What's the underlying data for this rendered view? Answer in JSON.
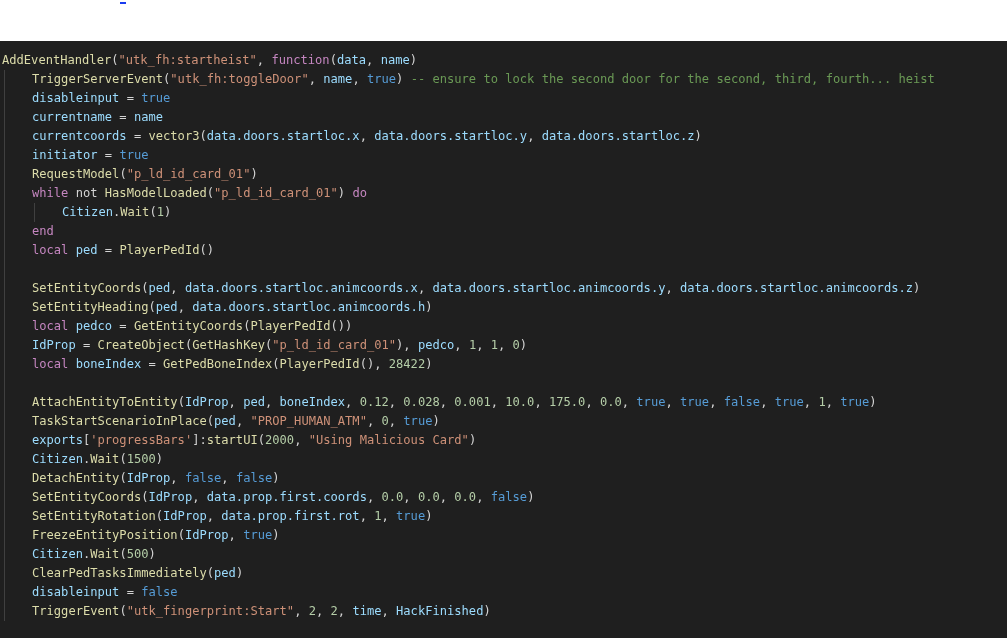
{
  "editor": {
    "lines": [
      {
        "kind": "code",
        "tokens": [
          {
            "kind": "fn",
            "text": "AddEventHandler"
          },
          {
            "kind": "punct",
            "text": "("
          },
          {
            "kind": "str",
            "text": "\"utk_fh:startheist\""
          },
          {
            "kind": "punct",
            "text": ", "
          },
          {
            "kind": "kw",
            "text": "function"
          },
          {
            "kind": "punct",
            "text": "("
          },
          {
            "kind": "var",
            "text": "data"
          },
          {
            "kind": "punct",
            "text": ", "
          },
          {
            "kind": "var",
            "text": "name"
          },
          {
            "kind": "punct",
            "text": ")"
          }
        ],
        "children": [
          {
            "kind": "code",
            "tokens": [
              {
                "kind": "fn",
                "text": "TriggerServerEvent"
              },
              {
                "kind": "punct",
                "text": "("
              },
              {
                "kind": "str",
                "text": "\"utk_fh:toggleDoor\""
              },
              {
                "kind": "punct",
                "text": ", "
              },
              {
                "kind": "var",
                "text": "name"
              },
              {
                "kind": "punct",
                "text": ", "
              },
              {
                "kind": "bool",
                "text": "true"
              },
              {
                "kind": "punct",
                "text": ") "
              },
              {
                "kind": "comment",
                "text": "-- ensure to lock the second door for the second, third, fourth... heist"
              }
            ]
          },
          {
            "kind": "code",
            "tokens": [
              {
                "kind": "var",
                "text": "disableinput"
              },
              {
                "kind": "punct",
                "text": " = "
              },
              {
                "kind": "bool",
                "text": "true"
              }
            ]
          },
          {
            "kind": "code",
            "tokens": [
              {
                "kind": "var",
                "text": "currentname"
              },
              {
                "kind": "punct",
                "text": " = "
              },
              {
                "kind": "var",
                "text": "name"
              }
            ]
          },
          {
            "kind": "code",
            "tokens": [
              {
                "kind": "var",
                "text": "currentcoords"
              },
              {
                "kind": "punct",
                "text": " = "
              },
              {
                "kind": "fn",
                "text": "vector3"
              },
              {
                "kind": "punct",
                "text": "("
              },
              {
                "kind": "var",
                "text": "data.doors.startloc.x"
              },
              {
                "kind": "punct",
                "text": ", "
              },
              {
                "kind": "var",
                "text": "data.doors.startloc.y"
              },
              {
                "kind": "punct",
                "text": ", "
              },
              {
                "kind": "var",
                "text": "data.doors.startloc.z"
              },
              {
                "kind": "punct",
                "text": ")"
              }
            ]
          },
          {
            "kind": "code",
            "tokens": [
              {
                "kind": "var",
                "text": "initiator"
              },
              {
                "kind": "punct",
                "text": " = "
              },
              {
                "kind": "bool",
                "text": "true"
              }
            ]
          },
          {
            "kind": "code",
            "tokens": [
              {
                "kind": "fn",
                "text": "RequestModel"
              },
              {
                "kind": "punct",
                "text": "("
              },
              {
                "kind": "str",
                "text": "\"p_ld_id_card_01\""
              },
              {
                "kind": "punct",
                "text": ")"
              }
            ]
          },
          {
            "kind": "code",
            "tokens": [
              {
                "kind": "kw",
                "text": "while"
              },
              {
                "kind": "punct",
                "text": " not "
              },
              {
                "kind": "fn",
                "text": "HasModelLoaded"
              },
              {
                "kind": "punct",
                "text": "("
              },
              {
                "kind": "str",
                "text": "\"p_ld_id_card_01\""
              },
              {
                "kind": "punct",
                "text": ") "
              },
              {
                "kind": "kw",
                "text": "do"
              }
            ],
            "children": [
              {
                "kind": "code",
                "tokens": [
                  {
                    "kind": "var",
                    "text": "Citizen"
                  },
                  {
                    "kind": "punct",
                    "text": "."
                  },
                  {
                    "kind": "fn",
                    "text": "Wait"
                  },
                  {
                    "kind": "punct",
                    "text": "("
                  },
                  {
                    "kind": "num",
                    "text": "1"
                  },
                  {
                    "kind": "punct",
                    "text": ")"
                  }
                ]
              }
            ]
          },
          {
            "kind": "code",
            "tokens": [
              {
                "kind": "kw",
                "text": "end"
              }
            ]
          },
          {
            "kind": "code",
            "tokens": [
              {
                "kind": "kw",
                "text": "local"
              },
              {
                "kind": "var",
                "text": " ped"
              },
              {
                "kind": "punct",
                "text": " = "
              },
              {
                "kind": "fn",
                "text": "PlayerPedId"
              },
              {
                "kind": "punct",
                "text": "()"
              }
            ]
          },
          {
            "kind": "blank"
          },
          {
            "kind": "code",
            "tokens": [
              {
                "kind": "fn",
                "text": "SetEntityCoords"
              },
              {
                "kind": "punct",
                "text": "("
              },
              {
                "kind": "var",
                "text": "ped"
              },
              {
                "kind": "punct",
                "text": ", "
              },
              {
                "kind": "var",
                "text": "data.doors.startloc.animcoords.x"
              },
              {
                "kind": "punct",
                "text": ", "
              },
              {
                "kind": "var",
                "text": "data.doors.startloc.animcoords.y"
              },
              {
                "kind": "punct",
                "text": ", "
              },
              {
                "kind": "var",
                "text": "data.doors.startloc.animcoords.z"
              },
              {
                "kind": "punct",
                "text": ")"
              }
            ]
          },
          {
            "kind": "code",
            "tokens": [
              {
                "kind": "fn",
                "text": "SetEntityHeading"
              },
              {
                "kind": "punct",
                "text": "("
              },
              {
                "kind": "var",
                "text": "ped"
              },
              {
                "kind": "punct",
                "text": ", "
              },
              {
                "kind": "var",
                "text": "data.doors.startloc.animcoords.h"
              },
              {
                "kind": "punct",
                "text": ")"
              }
            ]
          },
          {
            "kind": "code",
            "tokens": [
              {
                "kind": "kw",
                "text": "local"
              },
              {
                "kind": "var",
                "text": " pedco"
              },
              {
                "kind": "punct",
                "text": " = "
              },
              {
                "kind": "fn",
                "text": "GetEntityCoords"
              },
              {
                "kind": "punct",
                "text": "("
              },
              {
                "kind": "fn",
                "text": "PlayerPedId"
              },
              {
                "kind": "punct",
                "text": "())"
              }
            ]
          },
          {
            "kind": "code",
            "tokens": [
              {
                "kind": "var",
                "text": "IdProp"
              },
              {
                "kind": "punct",
                "text": " = "
              },
              {
                "kind": "fn",
                "text": "CreateObject"
              },
              {
                "kind": "punct",
                "text": "("
              },
              {
                "kind": "fn",
                "text": "GetHashKey"
              },
              {
                "kind": "punct",
                "text": "("
              },
              {
                "kind": "str",
                "text": "\"p_ld_id_card_01\""
              },
              {
                "kind": "punct",
                "text": "), "
              },
              {
                "kind": "var",
                "text": "pedco"
              },
              {
                "kind": "punct",
                "text": ", "
              },
              {
                "kind": "num",
                "text": "1"
              },
              {
                "kind": "punct",
                "text": ", "
              },
              {
                "kind": "num",
                "text": "1"
              },
              {
                "kind": "punct",
                "text": ", "
              },
              {
                "kind": "num",
                "text": "0"
              },
              {
                "kind": "punct",
                "text": ")"
              }
            ]
          },
          {
            "kind": "code",
            "tokens": [
              {
                "kind": "kw",
                "text": "local"
              },
              {
                "kind": "var",
                "text": " boneIndex"
              },
              {
                "kind": "punct",
                "text": " = "
              },
              {
                "kind": "fn",
                "text": "GetPedBoneIndex"
              },
              {
                "kind": "punct",
                "text": "("
              },
              {
                "kind": "fn",
                "text": "PlayerPedId"
              },
              {
                "kind": "punct",
                "text": "(), "
              },
              {
                "kind": "num",
                "text": "28422"
              },
              {
                "kind": "punct",
                "text": ")"
              }
            ]
          },
          {
            "kind": "blank"
          },
          {
            "kind": "code",
            "tokens": [
              {
                "kind": "fn",
                "text": "AttachEntityToEntity"
              },
              {
                "kind": "punct",
                "text": "("
              },
              {
                "kind": "var",
                "text": "IdProp"
              },
              {
                "kind": "punct",
                "text": ", "
              },
              {
                "kind": "var",
                "text": "ped"
              },
              {
                "kind": "punct",
                "text": ", "
              },
              {
                "kind": "var",
                "text": "boneIndex"
              },
              {
                "kind": "punct",
                "text": ", "
              },
              {
                "kind": "num",
                "text": "0.12"
              },
              {
                "kind": "punct",
                "text": ", "
              },
              {
                "kind": "num",
                "text": "0.028"
              },
              {
                "kind": "punct",
                "text": ", "
              },
              {
                "kind": "num",
                "text": "0.001"
              },
              {
                "kind": "punct",
                "text": ", "
              },
              {
                "kind": "num",
                "text": "10.0"
              },
              {
                "kind": "punct",
                "text": ", "
              },
              {
                "kind": "num",
                "text": "175.0"
              },
              {
                "kind": "punct",
                "text": ", "
              },
              {
                "kind": "num",
                "text": "0.0"
              },
              {
                "kind": "punct",
                "text": ", "
              },
              {
                "kind": "bool",
                "text": "true"
              },
              {
                "kind": "punct",
                "text": ", "
              },
              {
                "kind": "bool",
                "text": "true"
              },
              {
                "kind": "punct",
                "text": ", "
              },
              {
                "kind": "bool",
                "text": "false"
              },
              {
                "kind": "punct",
                "text": ", "
              },
              {
                "kind": "bool",
                "text": "true"
              },
              {
                "kind": "punct",
                "text": ", "
              },
              {
                "kind": "num",
                "text": "1"
              },
              {
                "kind": "punct",
                "text": ", "
              },
              {
                "kind": "bool",
                "text": "true"
              },
              {
                "kind": "punct",
                "text": ")"
              }
            ]
          },
          {
            "kind": "code",
            "tokens": [
              {
                "kind": "fn",
                "text": "TaskStartScenarioInPlace"
              },
              {
                "kind": "punct",
                "text": "("
              },
              {
                "kind": "var",
                "text": "ped"
              },
              {
                "kind": "punct",
                "text": ", "
              },
              {
                "kind": "str",
                "text": "\"PROP_HUMAN_ATM\""
              },
              {
                "kind": "punct",
                "text": ", "
              },
              {
                "kind": "num",
                "text": "0"
              },
              {
                "kind": "punct",
                "text": ", "
              },
              {
                "kind": "bool",
                "text": "true"
              },
              {
                "kind": "punct",
                "text": ")"
              }
            ]
          },
          {
            "kind": "code",
            "tokens": [
              {
                "kind": "var",
                "text": "exports"
              },
              {
                "kind": "punct",
                "text": "["
              },
              {
                "kind": "str",
                "text": "'progressBars'"
              },
              {
                "kind": "punct",
                "text": "]:"
              },
              {
                "kind": "fn",
                "text": "startUI"
              },
              {
                "kind": "punct",
                "text": "("
              },
              {
                "kind": "num",
                "text": "2000"
              },
              {
                "kind": "punct",
                "text": ", "
              },
              {
                "kind": "str",
                "text": "\"Using Malicious Card\""
              },
              {
                "kind": "punct",
                "text": ")"
              }
            ]
          },
          {
            "kind": "code",
            "tokens": [
              {
                "kind": "var",
                "text": "Citizen"
              },
              {
                "kind": "punct",
                "text": "."
              },
              {
                "kind": "fn",
                "text": "Wait"
              },
              {
                "kind": "punct",
                "text": "("
              },
              {
                "kind": "num",
                "text": "1500"
              },
              {
                "kind": "punct",
                "text": ")"
              }
            ]
          },
          {
            "kind": "code",
            "tokens": [
              {
                "kind": "fn",
                "text": "DetachEntity"
              },
              {
                "kind": "punct",
                "text": "("
              },
              {
                "kind": "var",
                "text": "IdProp"
              },
              {
                "kind": "punct",
                "text": ", "
              },
              {
                "kind": "bool",
                "text": "false"
              },
              {
                "kind": "punct",
                "text": ", "
              },
              {
                "kind": "bool",
                "text": "false"
              },
              {
                "kind": "punct",
                "text": ")"
              }
            ]
          },
          {
            "kind": "code",
            "tokens": [
              {
                "kind": "fn",
                "text": "SetEntityCoords"
              },
              {
                "kind": "punct",
                "text": "("
              },
              {
                "kind": "var",
                "text": "IdProp"
              },
              {
                "kind": "punct",
                "text": ", "
              },
              {
                "kind": "var",
                "text": "data.prop.first.coords"
              },
              {
                "kind": "punct",
                "text": ", "
              },
              {
                "kind": "num",
                "text": "0.0"
              },
              {
                "kind": "punct",
                "text": ", "
              },
              {
                "kind": "num",
                "text": "0.0"
              },
              {
                "kind": "punct",
                "text": ", "
              },
              {
                "kind": "num",
                "text": "0.0"
              },
              {
                "kind": "punct",
                "text": ", "
              },
              {
                "kind": "bool",
                "text": "false"
              },
              {
                "kind": "punct",
                "text": ")"
              }
            ]
          },
          {
            "kind": "code",
            "tokens": [
              {
                "kind": "fn",
                "text": "SetEntityRotation"
              },
              {
                "kind": "punct",
                "text": "("
              },
              {
                "kind": "var",
                "text": "IdProp"
              },
              {
                "kind": "punct",
                "text": ", "
              },
              {
                "kind": "var",
                "text": "data.prop.first.rot"
              },
              {
                "kind": "punct",
                "text": ", "
              },
              {
                "kind": "num",
                "text": "1"
              },
              {
                "kind": "punct",
                "text": ", "
              },
              {
                "kind": "bool",
                "text": "true"
              },
              {
                "kind": "punct",
                "text": ")"
              }
            ]
          },
          {
            "kind": "code",
            "tokens": [
              {
                "kind": "fn",
                "text": "FreezeEntityPosition"
              },
              {
                "kind": "punct",
                "text": "("
              },
              {
                "kind": "var",
                "text": "IdProp"
              },
              {
                "kind": "punct",
                "text": ", "
              },
              {
                "kind": "bool",
                "text": "true"
              },
              {
                "kind": "punct",
                "text": ")"
              }
            ]
          },
          {
            "kind": "code",
            "tokens": [
              {
                "kind": "var",
                "text": "Citizen"
              },
              {
                "kind": "punct",
                "text": "."
              },
              {
                "kind": "fn",
                "text": "Wait"
              },
              {
                "kind": "punct",
                "text": "("
              },
              {
                "kind": "num",
                "text": "500"
              },
              {
                "kind": "punct",
                "text": ")"
              }
            ]
          },
          {
            "kind": "code",
            "tokens": [
              {
                "kind": "fn",
                "text": "ClearPedTasksImmediately"
              },
              {
                "kind": "punct",
                "text": "("
              },
              {
                "kind": "var",
                "text": "ped"
              },
              {
                "kind": "punct",
                "text": ")"
              }
            ]
          },
          {
            "kind": "code",
            "tokens": [
              {
                "kind": "var",
                "text": "disableinput"
              },
              {
                "kind": "punct",
                "text": " = "
              },
              {
                "kind": "bool",
                "text": "false"
              }
            ]
          },
          {
            "kind": "code",
            "tokens": [
              {
                "kind": "fn",
                "text": "TriggerEvent"
              },
              {
                "kind": "punct",
                "text": "("
              },
              {
                "kind": "str",
                "text": "\"utk_fingerprint:Start\""
              },
              {
                "kind": "punct",
                "text": ", "
              },
              {
                "kind": "num",
                "text": "2"
              },
              {
                "kind": "punct",
                "text": ", "
              },
              {
                "kind": "num",
                "text": "2"
              },
              {
                "kind": "punct",
                "text": ", "
              },
              {
                "kind": "var",
                "text": "time"
              },
              {
                "kind": "punct",
                "text": ", "
              },
              {
                "kind": "var",
                "text": "HackFinished"
              },
              {
                "kind": "punct",
                "text": ")"
              }
            ]
          }
        ]
      }
    ]
  }
}
